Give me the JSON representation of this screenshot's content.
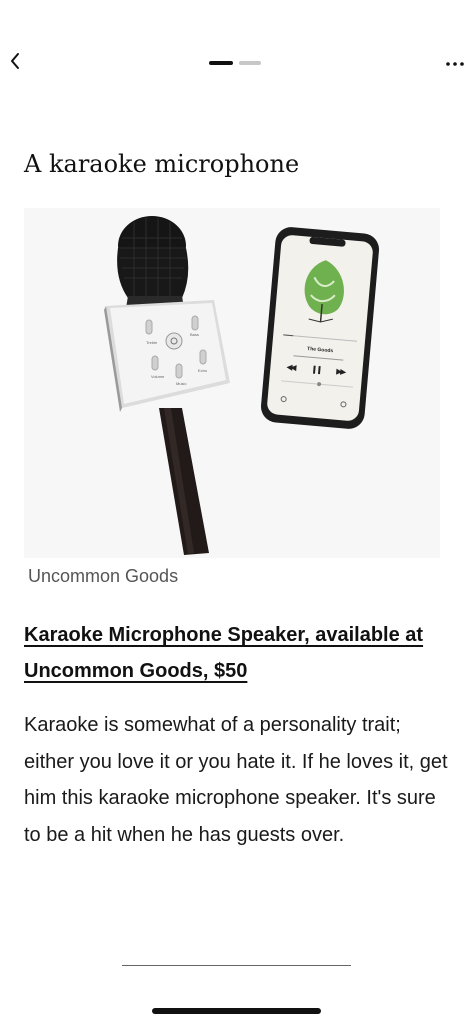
{
  "header": {
    "back_icon": "chevron-left-icon",
    "more_icon": "more-horizontal-icon",
    "pager": {
      "current": 1,
      "total": 2
    }
  },
  "article": {
    "heading": "A karaoke microphone",
    "image": {
      "mic_labels": [
        "Treble",
        "Bass",
        "Volume",
        "Music",
        "Echo"
      ],
      "phone_track": "The Goods"
    },
    "credit": "Uncommon Goods",
    "product_link": "Karaoke Microphone Speaker, available at Uncommon Goods, $50",
    "description": "Karaoke is somewhat of a personality trait; either you love it or you hate it. If he loves it, get him this karaoke microphone speaker. It's sure to be a hit when he has guests over."
  },
  "colors": {
    "background": "#ffffff",
    "text": "#1a1a1a",
    "credit": "#555555",
    "pager_inactive": "#c7c7c7"
  }
}
